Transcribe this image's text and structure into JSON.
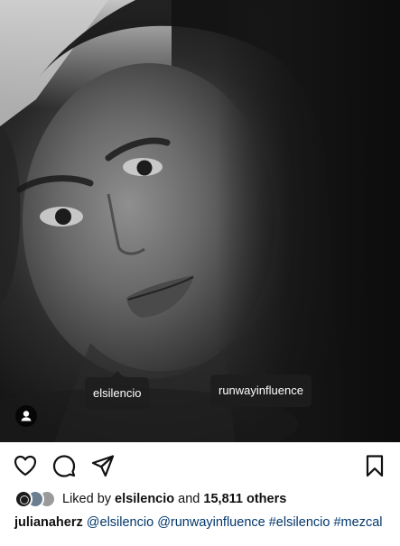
{
  "photo": {
    "alt_subject": "black-and-white portrait",
    "tags": [
      "elsilencio",
      "runwayinfluence"
    ]
  },
  "actions": {
    "icons": [
      "heart-icon",
      "comment-icon",
      "share-icon",
      "bookmark-icon"
    ]
  },
  "likes": {
    "prefix": "Liked by",
    "user": "elsilencio",
    "conjunction": "and",
    "count": "15,811 others"
  },
  "caption": {
    "username": "julianaherz",
    "mentions": [
      "@elsilencio",
      "@runwayinfluence"
    ],
    "hashtags": [
      "#elsilencio",
      "#mezcal"
    ]
  },
  "colors": {
    "link": "#00376b",
    "tag_bg": "#1e1e1e",
    "text": "#111111"
  }
}
